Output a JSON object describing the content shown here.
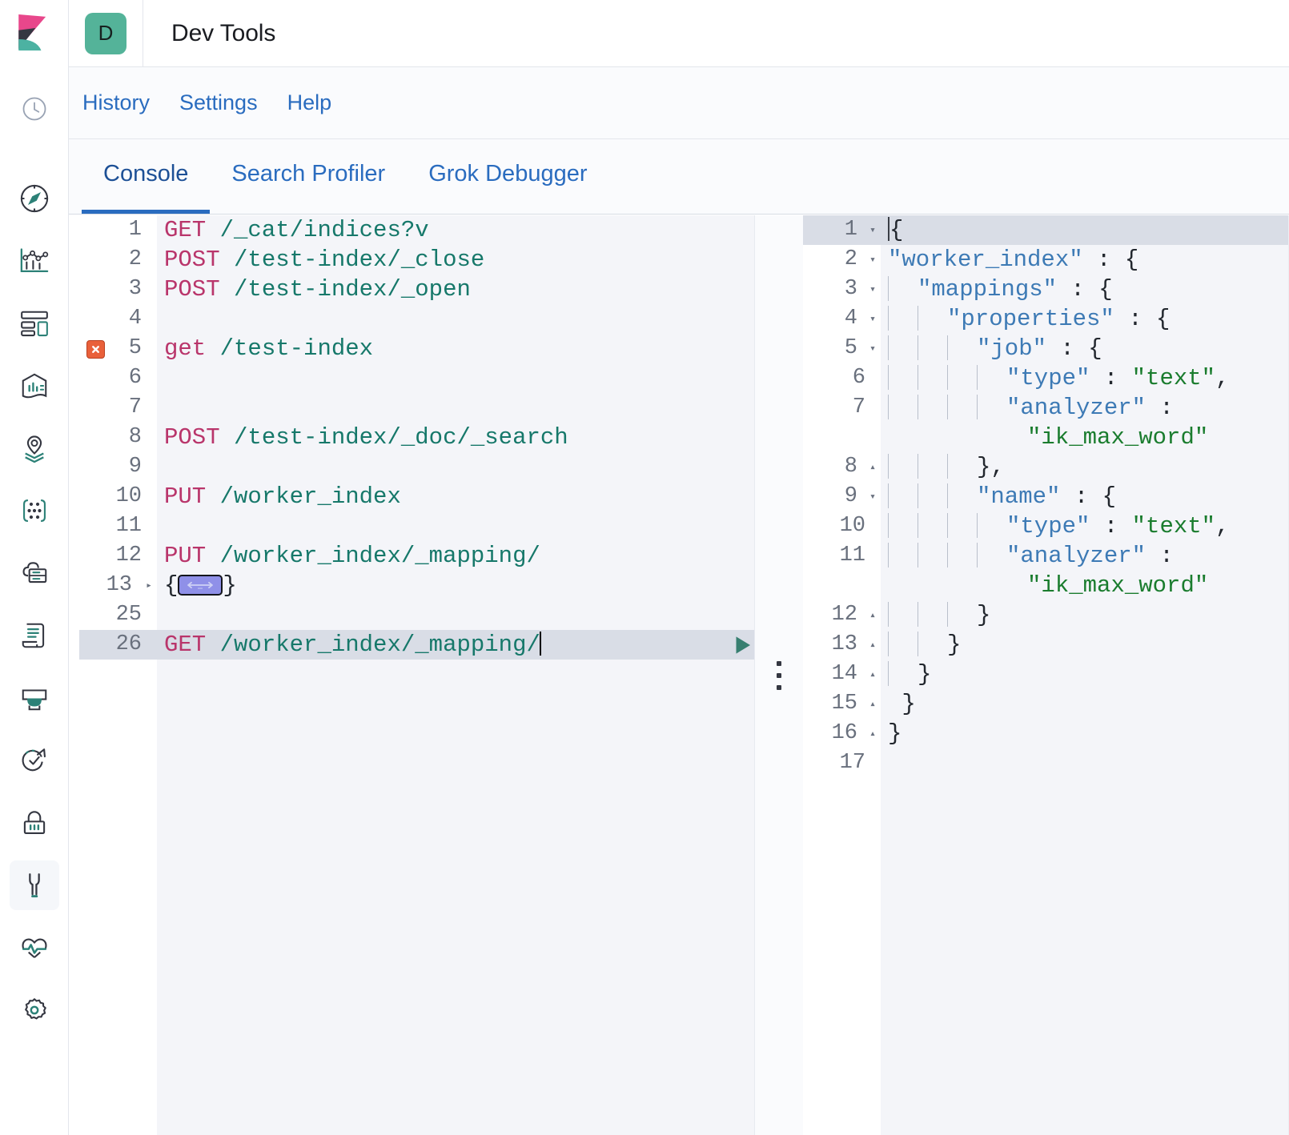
{
  "header": {
    "logo_icon": "kibana-logo",
    "space_badge": "D",
    "app_title": "Dev Tools"
  },
  "subheader": {
    "links": [
      {
        "label": "History",
        "name": "history"
      },
      {
        "label": "Settings",
        "name": "settings"
      },
      {
        "label": "Help",
        "name": "help"
      }
    ]
  },
  "tabs": [
    {
      "label": "Console",
      "active": true
    },
    {
      "label": "Search Profiler",
      "active": false
    },
    {
      "label": "Grok Debugger",
      "active": false
    }
  ],
  "sidebar": {
    "items": [
      {
        "icon": "recently-viewed-clock-icon",
        "label": "Recently viewed"
      },
      {
        "icon": "discover-compass-icon",
        "label": "Discover"
      },
      {
        "icon": "visualize-chart-icon",
        "label": "Visualize"
      },
      {
        "icon": "dashboard-icon",
        "label": "Dashboard"
      },
      {
        "icon": "canvas-icon",
        "label": "Canvas"
      },
      {
        "icon": "maps-pin-layers-icon",
        "label": "Maps"
      },
      {
        "icon": "machine-learning-icon",
        "label": "Machine Learning"
      },
      {
        "icon": "infrastructure-cloud-server-icon",
        "label": "Infrastructure"
      },
      {
        "icon": "logs-scroll-icon",
        "label": "Logs"
      },
      {
        "icon": "apm-icon",
        "label": "APM"
      },
      {
        "icon": "uptime-check-icon",
        "label": "Uptime"
      },
      {
        "icon": "siem-lock-icon",
        "label": "SIEM"
      },
      {
        "icon": "dev-tools-wrench-icon",
        "label": "Dev Tools",
        "active": true
      },
      {
        "icon": "monitoring-heartbeat-icon",
        "label": "Monitoring"
      },
      {
        "icon": "management-gear-icon",
        "label": "Management"
      }
    ]
  },
  "editor": {
    "name": "console-request-editor",
    "active_line": 26,
    "error_line": 5,
    "folded_line": 13,
    "cursor_after": "/",
    "run_icon": "play-triangle-icon",
    "wrench_icon": "wrench-icon",
    "fold_widget_icon": "double-arrow-icon",
    "lines": [
      {
        "no": "1",
        "method": "GET",
        "url": " /_cat/indices?v"
      },
      {
        "no": "2",
        "method": "POST",
        "url": " /test-index/_close"
      },
      {
        "no": "3",
        "method": "POST",
        "url": " /test-index/_open"
      },
      {
        "no": "4",
        "method": "",
        "url": ""
      },
      {
        "no": "5",
        "method": "get",
        "url": " /test-index",
        "error": true
      },
      {
        "no": "6",
        "method": "",
        "url": ""
      },
      {
        "no": "7",
        "method": "",
        "url": ""
      },
      {
        "no": "8",
        "method": "POST",
        "url": " /test-index/_doc/_search"
      },
      {
        "no": "9",
        "method": "",
        "url": ""
      },
      {
        "no": "10",
        "method": "PUT",
        "url": " /worker_index"
      },
      {
        "no": "11",
        "method": "",
        "url": ""
      },
      {
        "no": "12",
        "method": "PUT",
        "url": " /worker_index/_mapping/"
      },
      {
        "no": "13",
        "method": "",
        "url": "",
        "folded": true,
        "fold_open": "{",
        "fold_close": "}"
      },
      {
        "no": "25",
        "method": "",
        "url": ""
      },
      {
        "no": "26",
        "method": "GET",
        "url": " /worker_index/_mapping/",
        "active": true
      }
    ]
  },
  "response": {
    "name": "console-response-editor",
    "active_line": 1,
    "lines": [
      {
        "no": "1",
        "fold": "down",
        "indent": 0,
        "text": "{",
        "active": true
      },
      {
        "no": "2",
        "fold": "down",
        "indent": 0,
        "key": "\"worker_index\"",
        "rest": " : {"
      },
      {
        "no": "3",
        "fold": "down",
        "indent": 1,
        "key": "\"mappings\"",
        "rest": " : {"
      },
      {
        "no": "4",
        "fold": "down",
        "indent": 2,
        "key": "\"properties\"",
        "rest": " : {"
      },
      {
        "no": "5",
        "fold": "down",
        "indent": 3,
        "key": "\"job\"",
        "rest": " : {"
      },
      {
        "no": "6",
        "fold": "",
        "indent": 4,
        "key": "\"type\"",
        "rest": " : ",
        "str": "\"text\"",
        "tail": ","
      },
      {
        "no": "7",
        "fold": "",
        "indent": 4,
        "key": "\"analyzer\"",
        "rest": " : "
      },
      {
        "no": "",
        "fold": "",
        "indent": 0,
        "wrapstr": "\"ik_max_word\"",
        "wrap": true
      },
      {
        "no": "8",
        "fold": "up",
        "indent": 3,
        "text": "},",
        "brace": true
      },
      {
        "no": "9",
        "fold": "down",
        "indent": 3,
        "key": "\"name\"",
        "rest": " : {"
      },
      {
        "no": "10",
        "fold": "",
        "indent": 4,
        "key": "\"type\"",
        "rest": " : ",
        "str": "\"text\"",
        "tail": ","
      },
      {
        "no": "11",
        "fold": "",
        "indent": 4,
        "key": "\"analyzer\"",
        "rest": " : "
      },
      {
        "no": "",
        "fold": "",
        "indent": 0,
        "wrapstr": "\"ik_max_word\"",
        "wrap": true
      },
      {
        "no": "12",
        "fold": "up",
        "indent": 3,
        "text": "}",
        "brace": true
      },
      {
        "no": "13",
        "fold": "up",
        "indent": 2,
        "text": "}",
        "brace": true
      },
      {
        "no": "14",
        "fold": "up",
        "indent": 1,
        "text": "}",
        "brace": true
      },
      {
        "no": "15",
        "fold": "up",
        "indent": 0,
        "text": "}",
        "brace": true,
        "pad": 1
      },
      {
        "no": "16",
        "fold": "up",
        "indent": 0,
        "text": "}",
        "brace": true
      },
      {
        "no": "17",
        "fold": "",
        "indent": 0,
        "text": ""
      }
    ]
  },
  "splitter": {
    "name": "pane-drag-handle",
    "icon": "vertical-dots-handle-icon"
  },
  "colors": {
    "accent_blue": "#2a6cbf",
    "method_pink": "#b9356b",
    "url_teal": "#16786a",
    "json_key_blue": "#3d7ab5",
    "json_string_green": "#1a7c2e",
    "space_avatar_green": "#54b399",
    "error_orange": "#e9603a",
    "fold_widget_purple": "#8f90e8",
    "editor_bg": "#f4f5f9",
    "gutter_bg": "#ffffff",
    "active_line_bg": "#d9dde6"
  }
}
